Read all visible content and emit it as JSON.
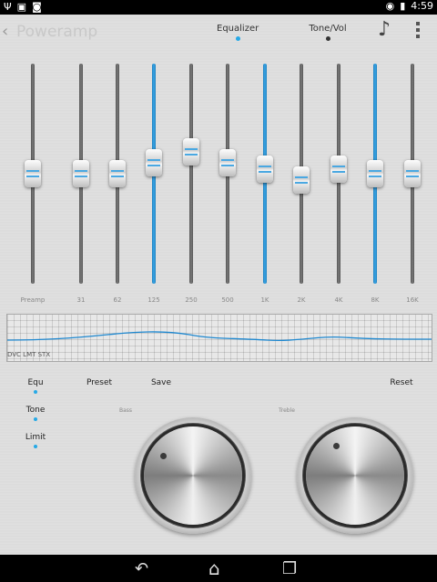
{
  "status_bar": {
    "time": "4:59"
  },
  "app_bar": {
    "title": "Poweramp",
    "tabs": [
      {
        "label": "Equalizer",
        "selected": true
      },
      {
        "label": "Tone/Vol",
        "selected": false
      }
    ]
  },
  "equalizer": {
    "bands": [
      {
        "label": "Preamp",
        "level": 0.5,
        "active": false
      },
      {
        "label": "31",
        "level": 0.5,
        "active": false
      },
      {
        "label": "62",
        "level": 0.5,
        "active": false
      },
      {
        "label": "125",
        "level": 0.55,
        "active": true
      },
      {
        "label": "250",
        "level": 0.6,
        "active": false
      },
      {
        "label": "500",
        "level": 0.55,
        "active": false
      },
      {
        "label": "1K",
        "level": 0.52,
        "active": true
      },
      {
        "label": "2K",
        "level": 0.47,
        "active": false
      },
      {
        "label": "4K",
        "level": 0.52,
        "active": false
      },
      {
        "label": "8K",
        "level": 0.5,
        "active": true
      },
      {
        "label": "16K",
        "level": 0.5,
        "active": false
      }
    ]
  },
  "curve": {
    "caption": "DVC LMT STX"
  },
  "controls": {
    "equ_label": "Equ",
    "preset_label": "Preset",
    "save_label": "Save",
    "reset_label": "Reset",
    "tone_label": "Tone",
    "limit_label": "Limit"
  },
  "knobs": {
    "bass_label": "Bass",
    "treble_label": "Treble"
  },
  "colors": {
    "accent": "#26A9E6",
    "track": "#666666"
  }
}
